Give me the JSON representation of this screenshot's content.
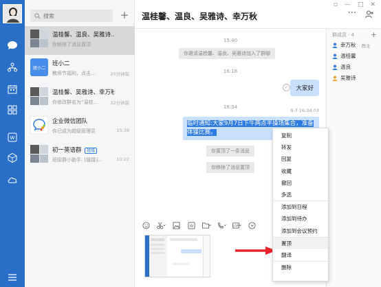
{
  "nav": {
    "icons": [
      "chat-icon",
      "contacts-icon",
      "calendar-icon",
      "workbench-icon",
      "wps-doc-icon",
      "cube-icon",
      "cloud-icon",
      "menu-icon"
    ]
  },
  "search": {
    "placeholder": "搜索"
  },
  "conversations": [
    {
      "name": "温桂馨、温良、吴雅诗...",
      "sub": "你移除了消息置顶",
      "time": ""
    },
    {
      "name": "班小二",
      "sub": "教师节福利，点击...",
      "time": "20分钟前",
      "logo": "班小二"
    },
    {
      "name": "温桂馨、吴雅诗、幸万秋",
      "sub": "你修改群名为“温桂...",
      "time": "32分钟前"
    },
    {
      "name": "企业微信团队",
      "sub": "你已成为超级管理员",
      "time": "15:39"
    },
    {
      "name": "初一英语群",
      "badge": "班级",
      "sub": "班级群小助手: [链接]...",
      "time": "10:22"
    }
  ],
  "chat": {
    "title": "温桂馨、温良、吴雅诗、幸万秋",
    "ts1": "15:40",
    "sys1": "你邀请温桂馨、温良、吴雅诗加入了群聊",
    "ts2": "16:18",
    "bubble": "大家好",
    "ts3": "16:34",
    "msg_time": "9-7 16:34:03",
    "selected_msg": "临时通知:大家9月7日下午两点半操场集合，准备体操比赛。",
    "sys2": "你置顶了一条消息",
    "sys3": "你移除了消息置顶"
  },
  "members": {
    "header": "群成员 · 4",
    "list": [
      {
        "name": "幸万秋",
        "tag": "· 群主",
        "color": "#2f7be5"
      },
      {
        "name": "温桂馨",
        "tag": "",
        "color": "#2f7be5"
      },
      {
        "name": "温良",
        "tag": "",
        "color": "#2f7be5"
      },
      {
        "name": "吴雅诗",
        "tag": "",
        "color": "#f0a030"
      }
    ]
  },
  "menu": {
    "group1": [
      "复制",
      "转发",
      "回复",
      "收藏",
      "撤回",
      "多选"
    ],
    "group2": [
      "添加到日程",
      "添加到待办",
      "添加到会议预约"
    ],
    "group3": [
      "置顶",
      "翻译"
    ],
    "group4": [
      "删除"
    ]
  },
  "colors": {
    "rail": "#2a6fc7",
    "accent": "#2f7be5",
    "arrow": "#e8232b"
  }
}
